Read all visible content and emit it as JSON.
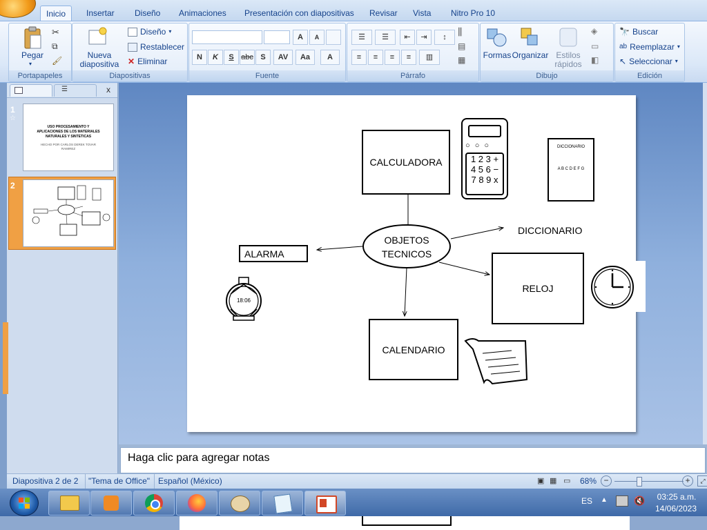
{
  "ribbon": {
    "tabs": [
      "Inicio",
      "Insertar",
      "Diseño",
      "Animaciones",
      "Presentación con diapositivas",
      "Revisar",
      "Vista",
      "Nitro Pro 10"
    ],
    "active_tab": "Inicio",
    "groups": {
      "portapapeles": {
        "label": "Portapapeles",
        "pegar": "Pegar"
      },
      "diapositivas": {
        "label": "Diapositivas",
        "nueva_1": "Nueva",
        "nueva_2": "diapositiva",
        "diseno": "Diseño",
        "restablecer": "Restablecer",
        "eliminar": "Eliminar"
      },
      "fuente": {
        "label": "Fuente",
        "bold": "N",
        "italic": "K",
        "underline": "S",
        "strike": "abc",
        "shadow": "S",
        "spacing": "AV",
        "case": "Aa",
        "grow": "A",
        "shrink": "A",
        "color": "A"
      },
      "parrafo": {
        "label": "Párrafo"
      },
      "dibujo": {
        "label": "Dibujo",
        "formas": "Formas",
        "organizar": "Organizar",
        "estilos_1": "Estilos",
        "estilos_2": "rápidos"
      },
      "edicion": {
        "label": "Edición",
        "buscar": "Buscar",
        "reemplazar": "Reemplazar",
        "seleccionar": "Seleccionar"
      }
    }
  },
  "slides_panel": {
    "close": "x",
    "thumbs": [
      {
        "number": "1",
        "title_lines": [
          "USO PROCESAMIENTO Y",
          "APLICACIONES DE LOS MATERIALES",
          "NATURALES Y SINTETICAS"
        ],
        "subtitle_lines": [
          "HECHO POR CARLOS DEREK TOVAR",
          "RAMIREZ"
        ]
      },
      {
        "number": "2"
      }
    ]
  },
  "slide": {
    "center": [
      "OBJETOS",
      "TECNICOS"
    ],
    "calculadora": "CALCULADORA",
    "diccionario": "DICCIONARIO",
    "alarma": "ALARMA",
    "reloj": "RELOJ",
    "calendario": "CALENDARIO",
    "dict_book_title": "DICCIONARIO",
    "dict_book_text": "A B C D E F G",
    "alarm_time": "18:06",
    "calc_rows": [
      "1 2 3 +",
      "4 5 6 −",
      "7 8 9 x"
    ]
  },
  "notes": {
    "placeholder": "Haga clic para agregar notas"
  },
  "status": {
    "slide": "Diapositiva 2 de 2",
    "theme": "\"Tema de Office\"",
    "language": "Español (México)",
    "zoom": "68%"
  },
  "taskbar": {
    "lang": "ES",
    "time": "03:25 a.m.",
    "date": "14/06/2023"
  }
}
